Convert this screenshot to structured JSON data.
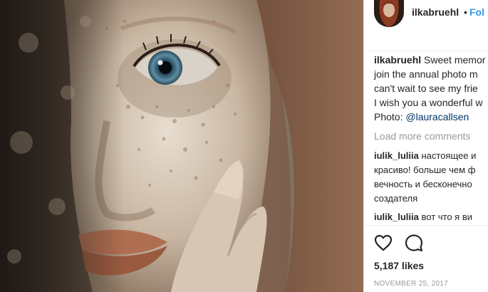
{
  "post": {
    "username": "ilkabruehl",
    "separator": "•",
    "follow_label": "Fol",
    "caption_lines": [
      "Sweet memor",
      "join the annual photo m",
      "can't wait to see my frie",
      "I wish you a wonderful w"
    ],
    "photo_label": "Photo:",
    "photo_credit": "@lauracallsen"
  },
  "comments": {
    "load_more": "Load more comments",
    "items": [
      {
        "user": "iulik_luliia",
        "lines": [
          "настоящее и",
          "красиво! больше чем ф",
          "вечность и бесконечно",
          "создателя"
        ]
      },
      {
        "user": "iulik_luliia",
        "lines": [
          "вот что я ви"
        ]
      }
    ]
  },
  "actions": {
    "like_icon": "heart-icon",
    "comment_icon": "speech-bubble-icon",
    "likes": "5,187 likes",
    "date": "NOVEMBER 25, 2017"
  },
  "colors": {
    "link": "#3897f0",
    "mention": "#003569",
    "muted": "#999999",
    "text": "#262626"
  }
}
